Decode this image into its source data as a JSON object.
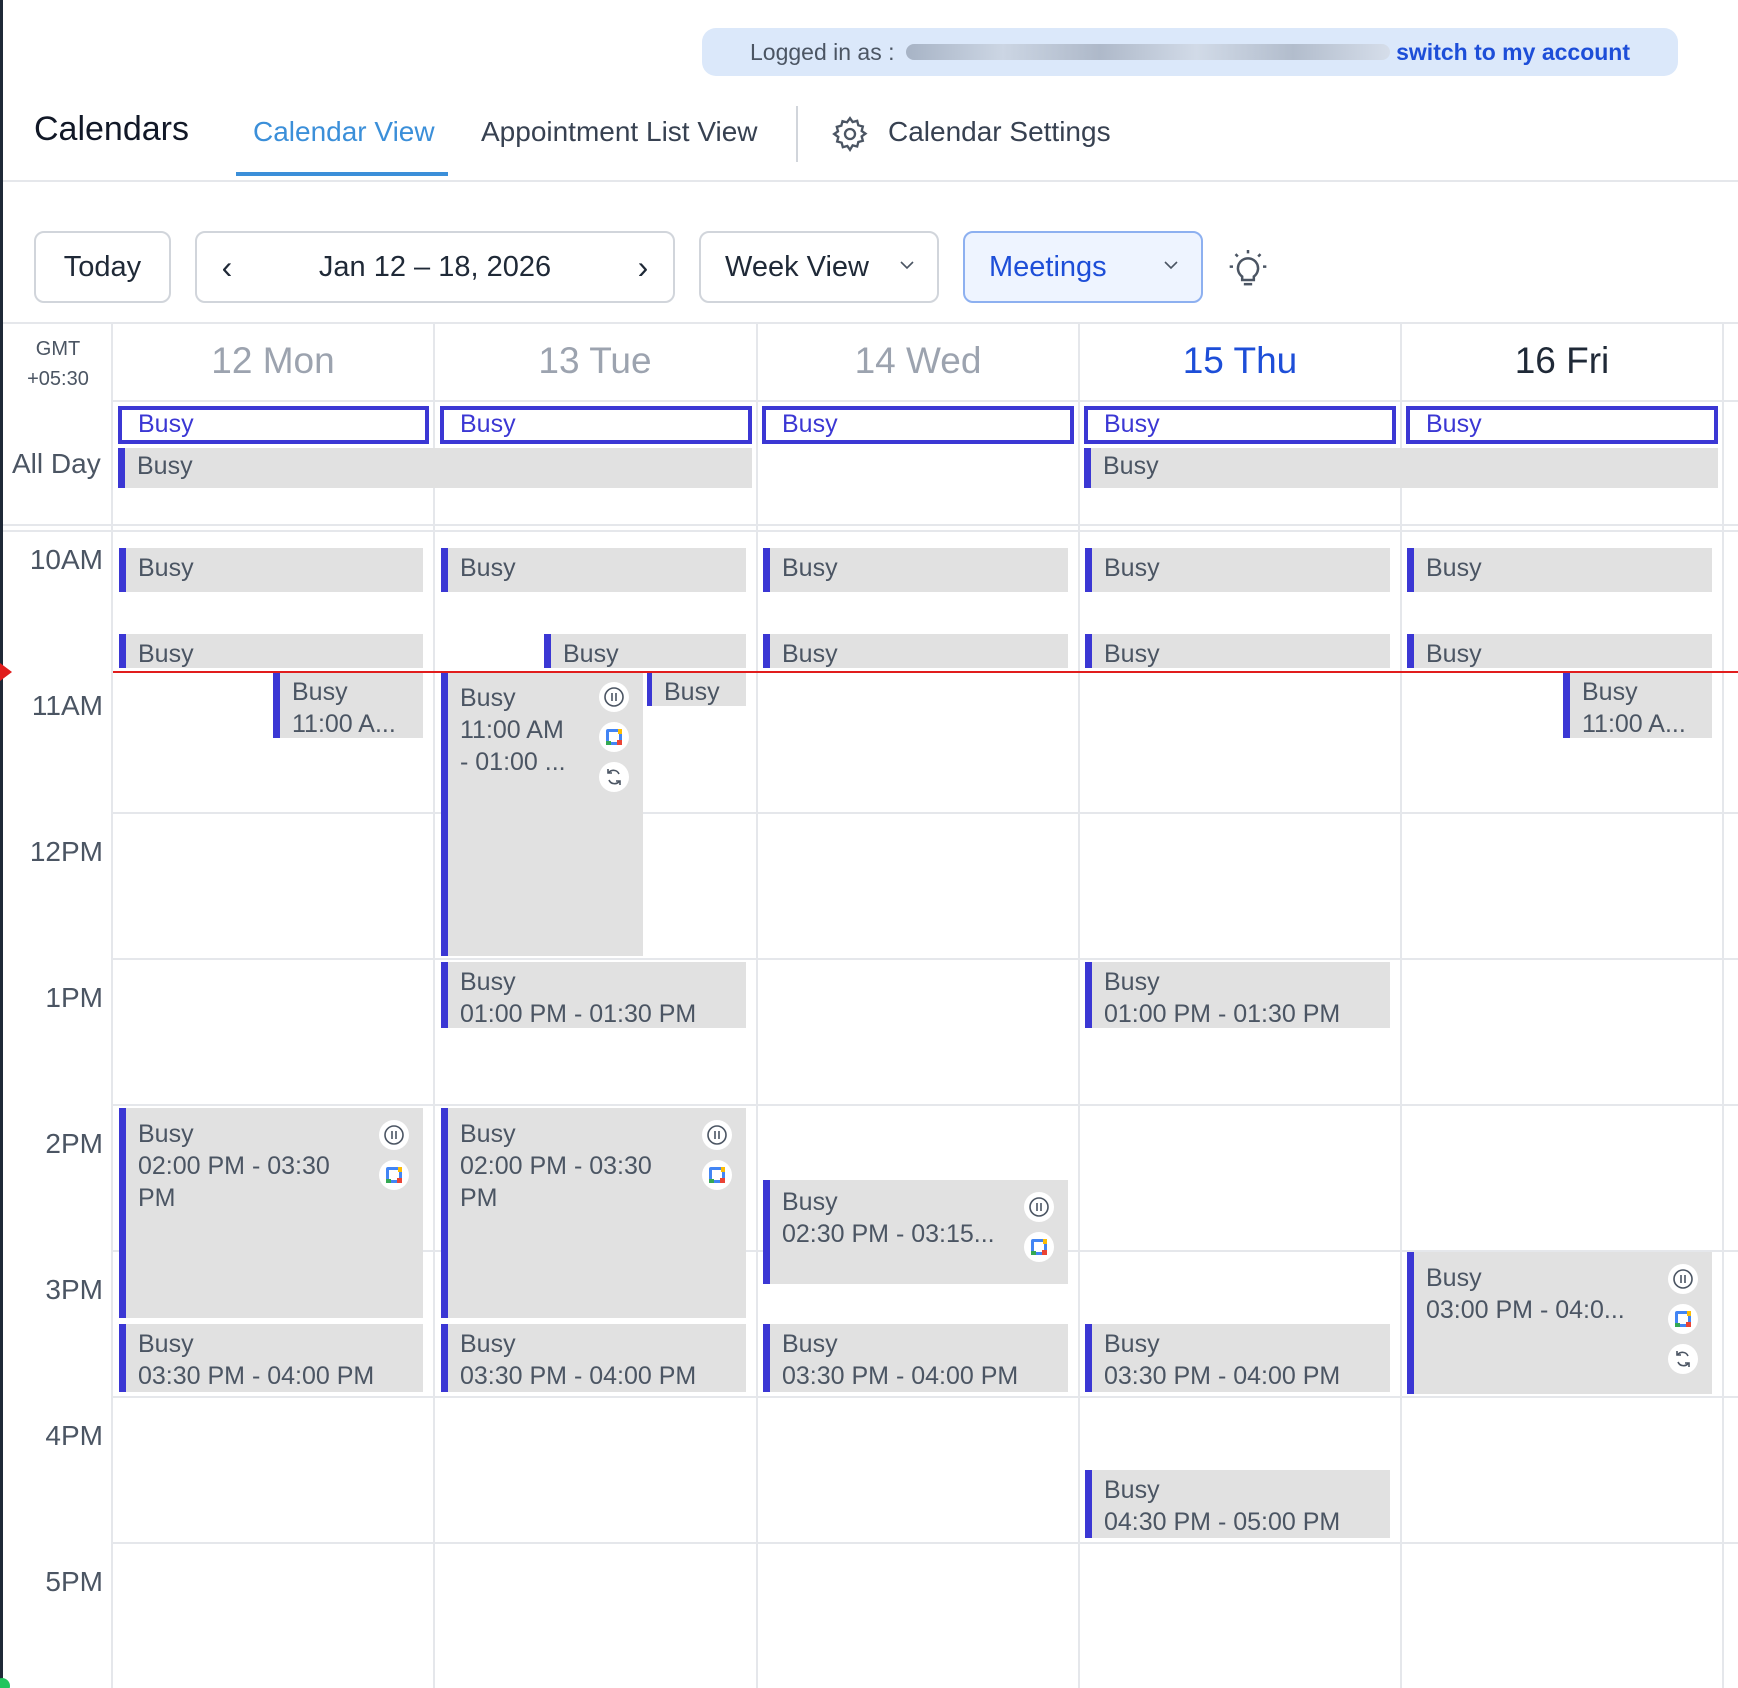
{
  "banner": {
    "logged_in_prefix": "Logged in as :",
    "switch_link": "switch to my account"
  },
  "header": {
    "title": "Calendars",
    "tabs": {
      "calendar_view": "Calendar View",
      "appointment_list": "Appointment List View",
      "settings": "Calendar Settings"
    }
  },
  "toolbar": {
    "today": "Today",
    "date_range": "Jan 12 – 18, 2026",
    "view_select": "Week View",
    "calendar_select": "Meetings"
  },
  "grid": {
    "timezone": {
      "line1": "GMT",
      "line2": "+05:30"
    },
    "days": [
      "12 Mon",
      "13 Tue",
      "14 Wed",
      "15 Thu",
      "16 Fri"
    ],
    "all_day_label": "All Day",
    "hours": [
      "10AM",
      "11AM",
      "12PM",
      "1PM",
      "2PM",
      "3PM",
      "4PM",
      "5PM"
    ]
  },
  "events": {
    "busy": "Busy",
    "t_1100_trunc": "11:00 A...",
    "t_1100_am": "11:00 AM",
    "t_1100_0100_trunc": "- 01:00 ...",
    "t_1300_1330": "01:00 PM - 01:30 PM",
    "t_1400_1530_a": "02:00 PM - 03:30",
    "t_pm": "PM",
    "t_1430_1515": "02:30 PM - 03:15...",
    "t_1500_1600": "03:00 PM - 04:0...",
    "t_1530_1600": "03:30 PM - 04:00 PM",
    "t_1630_1700": "04:30 PM - 05:00 PM"
  },
  "colors": {
    "accent": "#3b37d4",
    "link": "#1d4ed8",
    "today": "#1d4ed8",
    "now_line": "#e11d1d",
    "event_bg": "#e1e1e1"
  },
  "icons": [
    "settings-gear-icon",
    "chevron-left-icon",
    "chevron-right-icon",
    "chevron-down-icon",
    "lightbulb-icon",
    "pause-icon",
    "google-calendar-icon",
    "sync-icon"
  ]
}
